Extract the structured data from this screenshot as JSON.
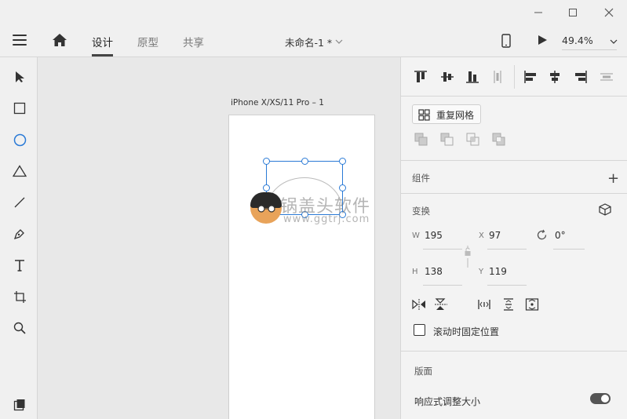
{
  "window": {
    "minimize_glyph": "—",
    "maximize_glyph": "☐",
    "close_glyph": "✕"
  },
  "header": {
    "tabs": [
      {
        "label": "设计",
        "active": true
      },
      {
        "label": "原型",
        "active": false
      },
      {
        "label": "共享",
        "active": false
      }
    ],
    "doc_title": "未命名-1 *",
    "zoom": "49.4%"
  },
  "toolbar": {
    "tools": [
      "select-icon",
      "rectangle-icon",
      "ellipse-icon",
      "triangle-icon",
      "line-icon",
      "pen-icon",
      "text-icon",
      "artboard-icon",
      "zoom-icon",
      "assets-icon"
    ],
    "active_tool": "ellipse-icon"
  },
  "canvas": {
    "artboard_label": "iPhone X/XS/11 Pro – 1",
    "watermark_text": "锅盖头软件",
    "watermark_url": "www.ggtrj.com"
  },
  "panel": {
    "repeat_grid_label": "重复网格",
    "components_title": "组件",
    "add_glyph": "+",
    "transform_title": "变换",
    "w_label": "W",
    "w_value": "195",
    "x_label": "X",
    "x_value": "97",
    "rotation_value": "0°",
    "h_label": "H",
    "h_value": "138",
    "y_label": "Y",
    "y_value": "119",
    "fix_scroll_label": "滚动时固定位置",
    "fix_scroll_checked": false,
    "layout_title": "版面",
    "responsive_label": "响应式调整大小",
    "responsive_on": true
  },
  "colors": {
    "selection": "#2a7ad6",
    "toolbar_bg": "#f0f0f0",
    "canvas_bg": "#e8e8e8"
  }
}
